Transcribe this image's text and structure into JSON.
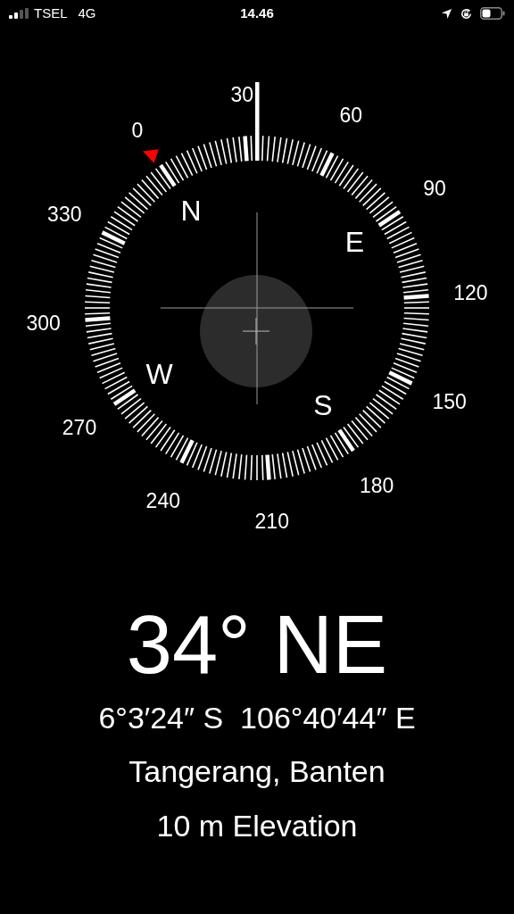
{
  "status_bar": {
    "carrier": "TSEL",
    "network": "4G",
    "time": "14.46"
  },
  "compass": {
    "degree_labels": [
      "0",
      "30",
      "60",
      "90",
      "120",
      "150",
      "180",
      "210",
      "240",
      "270",
      "300",
      "330"
    ],
    "cardinals": [
      "N",
      "E",
      "S",
      "W"
    ]
  },
  "heading": "34° NE",
  "coordinates": "6°3′24″ S  106°40′44″ E",
  "place": "Tangerang, Banten",
  "elevation": "10 m Elevation"
}
